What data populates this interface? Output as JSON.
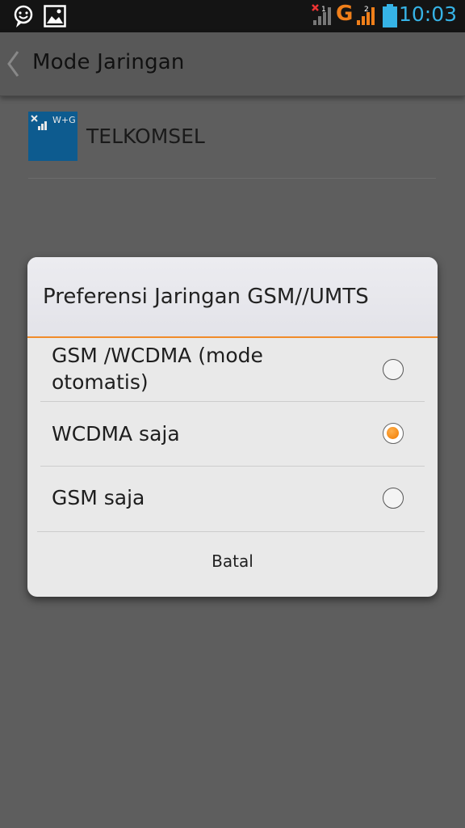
{
  "status_bar": {
    "time": "10:03",
    "sim1_label": "1",
    "sim2_label": "2",
    "network_type": "G",
    "icons": [
      "smiley-notification-icon",
      "image-notification-icon",
      "signal-sim1-icon",
      "signal-sim2-icon",
      "battery-icon"
    ],
    "clock_color": "#36b3e6"
  },
  "action_bar": {
    "title": "Mode Jaringan"
  },
  "sim": {
    "badge": "W+G",
    "name": "TELKOMSEL",
    "tile_color": "#0d5b8f"
  },
  "dialog": {
    "title": "Preferensi Jaringan GSM//UMTS",
    "accent_color": "#f18b2a",
    "options": [
      {
        "label_line1": "GSM /WCDMA (mode",
        "label_line2": "otomatis)",
        "selected": false
      },
      {
        "label": "WCDMA saja",
        "selected": true
      },
      {
        "label": "GSM saja",
        "selected": false
      }
    ],
    "cancel_label": "Batal"
  }
}
